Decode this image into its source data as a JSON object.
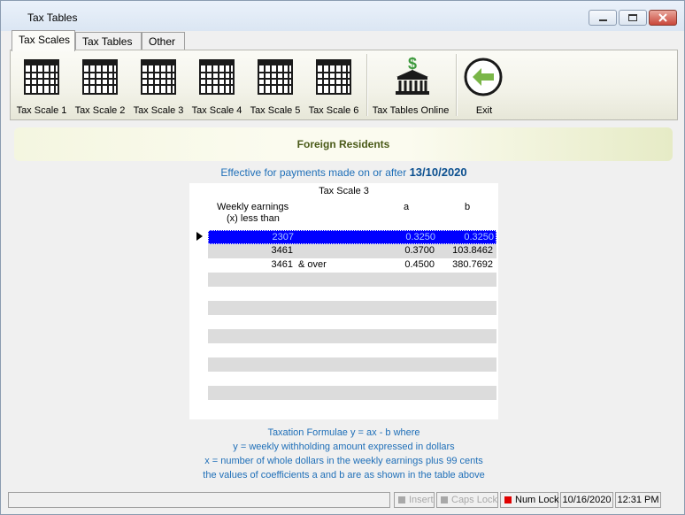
{
  "window": {
    "title": "Tax Tables"
  },
  "tabs": [
    "Tax Scales",
    "Tax Tables",
    "Other"
  ],
  "ribbon": {
    "buttons": [
      {
        "label": "Tax Scale 1",
        "icon": "calendar-grid-icon"
      },
      {
        "label": "Tax Scale 2",
        "icon": "calendar-grid-icon"
      },
      {
        "label": "Tax Scale 3",
        "icon": "calendar-grid-icon"
      },
      {
        "label": "Tax Scale 4",
        "icon": "calendar-grid-icon"
      },
      {
        "label": "Tax Scale 5",
        "icon": "calendar-grid-icon"
      },
      {
        "label": "Tax Scale 6",
        "icon": "calendar-grid-icon"
      },
      {
        "label": "Tax Tables Online",
        "icon": "bank-dollar-icon"
      },
      {
        "label": "Exit",
        "icon": "back-arrow-icon"
      }
    ]
  },
  "banner": {
    "title": "Foreign Residents"
  },
  "effective": {
    "text": "Effective for payments made on or after",
    "date": "13/10/2020"
  },
  "table": {
    "title": "Tax Scale 3",
    "col_earnings_1": "Weekly earnings",
    "col_earnings_2": "(x) less than",
    "col_a": "a",
    "col_b": "b",
    "rows": [
      {
        "earnings": "2307",
        "suffix": "",
        "a": "0.3250",
        "b": "0.3250"
      },
      {
        "earnings": "3461",
        "suffix": "",
        "a": "0.3700",
        "b": "103.8462"
      },
      {
        "earnings": "3461",
        "suffix": "& over",
        "a": "0.4500",
        "b": "380.7692"
      }
    ]
  },
  "formulae": [
    "Taxation Formulae y = ax - b where",
    "y = weekly withholding amount expressed in dollars",
    "x = number of whole dollars in the weekly earnings plus 99 cents",
    "the values of coefficients a and b are as shown in the table above"
  ],
  "statusbar": {
    "insert": "Insert",
    "caps": "Caps Lock",
    "num": "Num Lock",
    "date": "10/16/2020",
    "time": "12:31 PM"
  },
  "colors": {
    "accent": "#1f6fb8",
    "selection": "#0000ff",
    "exit_green": "#7ab648",
    "num_lock_led": "#e00000"
  }
}
